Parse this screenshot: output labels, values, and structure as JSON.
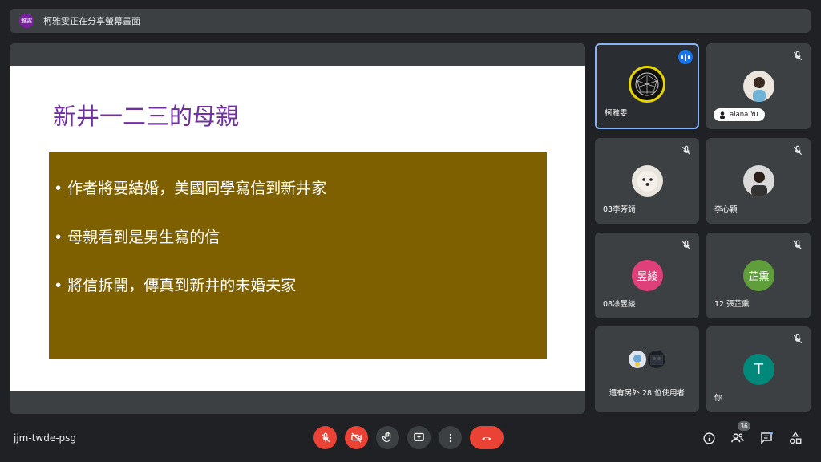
{
  "topbar": {
    "presenter_initials": "雅雯",
    "presenting_text": "柯雅雯正在分享螢幕畫面"
  },
  "slide": {
    "title": "新井一二三的母親",
    "bullet_symbol": "•",
    "bullets": [
      "作者將要結婚，美國同學寫信到新井家",
      "母親看到是男生寫的信",
      "將信拆開，傳真到新井的未婚夫家"
    ]
  },
  "tiles": [
    {
      "name": "柯雅雯",
      "avatar_text": "",
      "avatar_color": "#2b2b2b",
      "muted": false,
      "speaking": true
    },
    {
      "name": "alana Yu",
      "avatar_text": "",
      "avatar_color": "#e8e0d8",
      "muted": true,
      "pill": true
    },
    {
      "name": "03李芳錡",
      "avatar_text": "",
      "avatar_color": "#d8cfc4",
      "muted": true
    },
    {
      "name": "李心穎",
      "avatar_text": "",
      "avatar_color": "#cfcfcf",
      "muted": true
    },
    {
      "name": "08凃昱綾",
      "avatar_text": "昱綾",
      "avatar_color": "#e0407a",
      "muted": true
    },
    {
      "name": "12 張芷熏",
      "avatar_text": "芷熏",
      "avatar_color": "#5f9e3a",
      "muted": true
    },
    {
      "name": "還有另外 28 位使用者",
      "avatar_text": "",
      "muted": false,
      "others": true
    },
    {
      "name": "你",
      "avatar_text": "T",
      "avatar_color": "#00897b",
      "muted": true
    }
  ],
  "bottombar": {
    "meeting_code": "jjm-twde-psg",
    "participants_count": "36"
  },
  "colors": {
    "background": "#202124",
    "slide_title": "#7030a0",
    "slide_box": "#7f6000",
    "control_red": "#ea4335",
    "speaking_blue": "#1a73e8"
  },
  "icons": {
    "mic": "mic-off-icon",
    "camera": "camera-off-icon",
    "hand": "raise-hand-icon",
    "present": "present-screen-icon",
    "more": "more-options-icon",
    "hangup": "hang-up-icon",
    "info": "info-icon",
    "people": "people-icon",
    "chat": "chat-icon",
    "activities": "activities-icon"
  }
}
